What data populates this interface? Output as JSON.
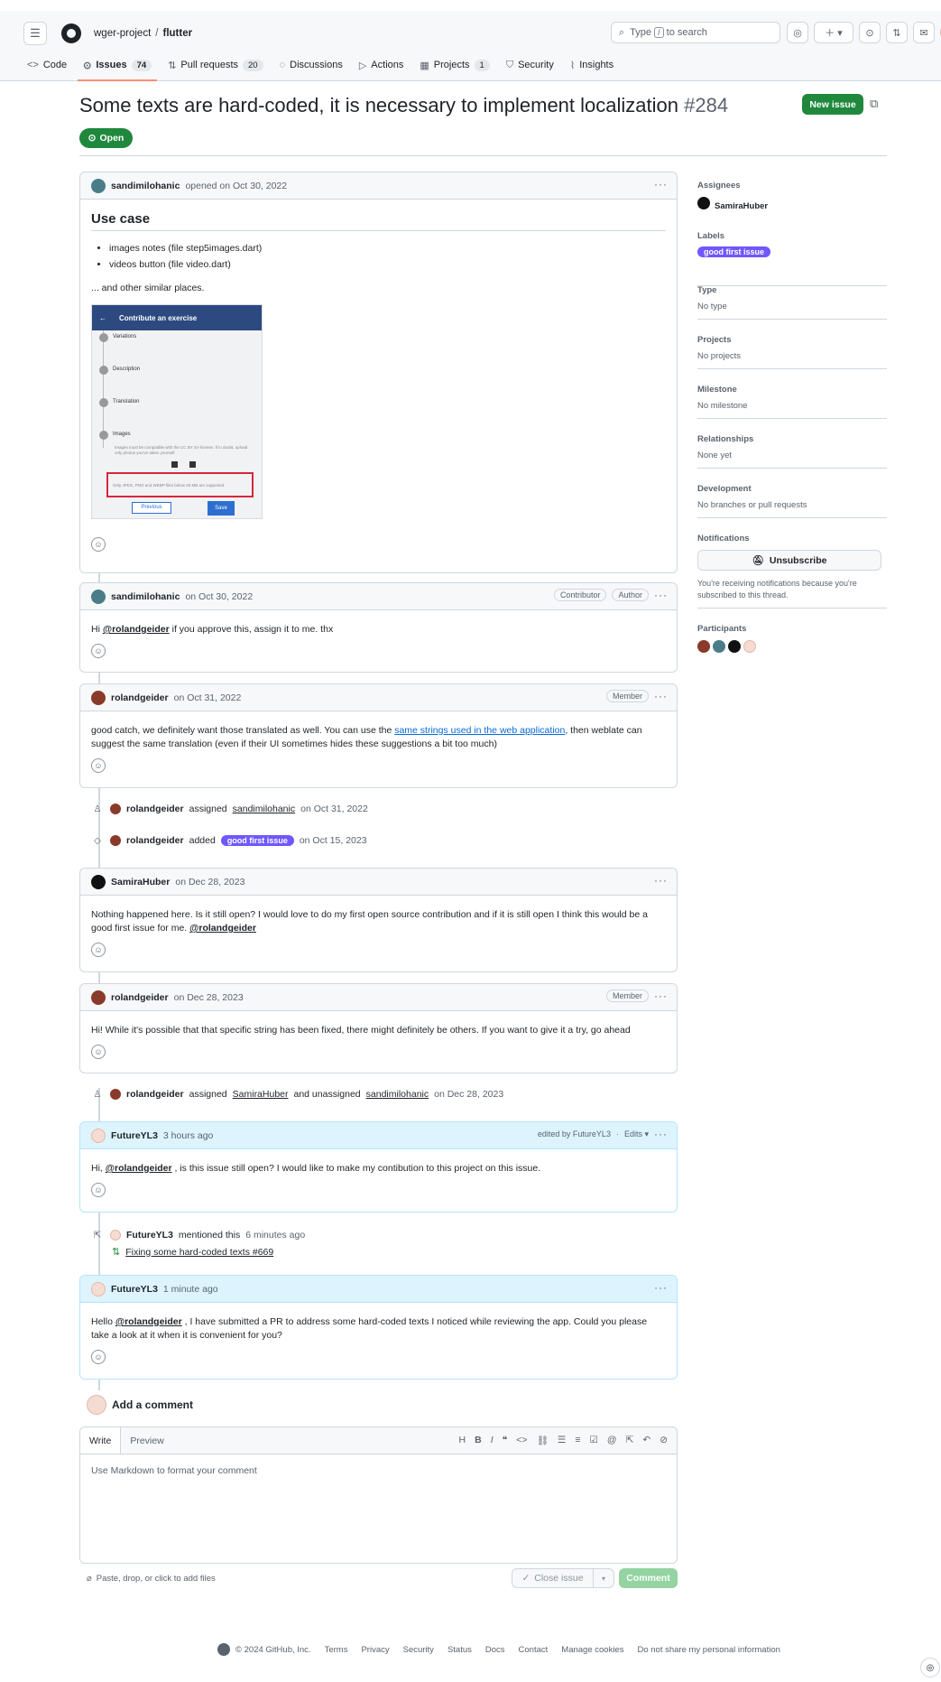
{
  "header": {
    "owner": "wger-project",
    "repo": "flutter",
    "search_placeholder": "Type / to search",
    "search_key": "/"
  },
  "tabs": [
    {
      "label": "Code"
    },
    {
      "label": "Issues",
      "count": "74"
    },
    {
      "label": "Pull requests",
      "count": "20"
    },
    {
      "label": "Discussions"
    },
    {
      "label": "Actions"
    },
    {
      "label": "Projects",
      "count": "1"
    },
    {
      "label": "Security"
    },
    {
      "label": "Insights"
    }
  ],
  "issue": {
    "title": "Some texts are hard-coded, it is necessary to implement localization",
    "number": "#284",
    "state": "Open",
    "new_issue_label": "New issue"
  },
  "opening": {
    "author": "sandimilohanic",
    "meta": "opened on Oct 30, 2022",
    "heading": "Use case",
    "bullets": [
      "images notes (file step5images.dart)",
      "videos button (file video.dart)"
    ],
    "after": "... and other similar places.",
    "screenshot": {
      "appbar": "Contribute an exercise",
      "steps": [
        "Variations",
        "Description",
        "Translation",
        "Images"
      ],
      "step_nums": [
        "2",
        "3",
        "4",
        "5"
      ],
      "msg": "Images must be compatible with the CC BY SA license. If in doubt, upload only photos you've taken yourself.",
      "redbox": "Only JPEG, PNG and WEBP files below 20 MB are supported",
      "prev": "Previous",
      "save": "Save"
    }
  },
  "comments": [
    {
      "author": "sandimilohanic",
      "meta": "on Oct 30, 2022",
      "badges": [
        "Contributor",
        "Author"
      ],
      "pre": "Hi ",
      "mention": "@rolandgeider",
      "post": " if you approve this, assign it to me. thx"
    },
    {
      "author": "rolandgeider",
      "meta": "on Oct 31, 2022",
      "badges": [
        "Member"
      ],
      "pre": "good catch, we definitely want those translated as well. You can use the ",
      "link": "same strings used in the web application",
      "post": ", then weblate can suggest the same translation (even if their UI sometimes hides these suggestions a bit too much)"
    },
    {
      "author": "SamiraHuber",
      "meta": "on Dec 28, 2023",
      "pre": "Nothing happened here. Is it still open? I would love to do my first open source contribution and if it is still open I think this would be a good first issue for me. ",
      "mention": "@rolandgeider"
    },
    {
      "author": "rolandgeider",
      "meta": "on Dec 28, 2023",
      "badges": [
        "Member"
      ],
      "pre": "Hi! While it's possible that that specific string has been fixed, there might definitely be others. If you want to give it a try, go ahead"
    },
    {
      "author": "FutureYL3",
      "meta": "3 hours ago",
      "edited": "edited by FutureYL3",
      "edits": "Edits",
      "pre": "Hi, ",
      "mention": "@rolandgeider",
      "post": " , is this issue still open? I would like to make my contibution to this project on this issue."
    },
    {
      "author": "FutureYL3",
      "meta": "1 minute ago",
      "pre": "Hello ",
      "mention": "@rolandgeider",
      "post": " , I have submitted a PR to address some hard-coded texts I noticed while reviewing the app. Could you please take a look at it when it is convenient for you?"
    }
  ],
  "events": {
    "e1": {
      "actor": "rolandgeider",
      "verb": "assigned",
      "target": "sandimilohanic",
      "when": "on Oct 31, 2022"
    },
    "e2": {
      "actor": "rolandgeider",
      "verb": "added",
      "label": "good first issue",
      "when": "on Oct 15, 2023"
    },
    "e3": {
      "actor": "rolandgeider",
      "verb": "assigned",
      "target": "SamiraHuber",
      "mid": "and unassigned",
      "target2": "sandimilohanic",
      "when": "on Dec 28, 2023"
    },
    "e4": {
      "actor": "FutureYL3",
      "verb": "mentioned this",
      "when": "6 minutes ago",
      "pr": "Fixing some hard-coded texts #669"
    }
  },
  "sidebar": {
    "assignees_h": "Assignees",
    "assignee": "SamiraHuber",
    "labels_h": "Labels",
    "label": "good first issue",
    "type_h": "Type",
    "type_v": "No type",
    "projects_h": "Projects",
    "projects_v": "No projects",
    "milestone_h": "Milestone",
    "milestone_v": "No milestone",
    "relationships_h": "Relationships",
    "relationships_v": "None yet",
    "development_h": "Development",
    "development_v": "No branches or pull requests",
    "notifications_h": "Notifications",
    "unsubscribe": "Unsubscribe",
    "notif_note": "You're receiving notifications because you're subscribed to this thread.",
    "participants_h": "Participants"
  },
  "composer": {
    "heading": "Add a comment",
    "write": "Write",
    "preview": "Preview",
    "placeholder": "Use Markdown to format your comment",
    "attach": "Paste, drop, or click to add files",
    "close_issue": "Close issue",
    "comment": "Comment"
  },
  "footer": {
    "copyright": "© 2024 GitHub, Inc.",
    "links": [
      "Terms",
      "Privacy",
      "Security",
      "Status",
      "Docs",
      "Contact",
      "Manage cookies",
      "Do not share my personal information"
    ]
  },
  "colors": {
    "accent": "#1f883d",
    "label": "#7057ff",
    "link": "#0969da",
    "tab_underline": "#fd8c73"
  }
}
